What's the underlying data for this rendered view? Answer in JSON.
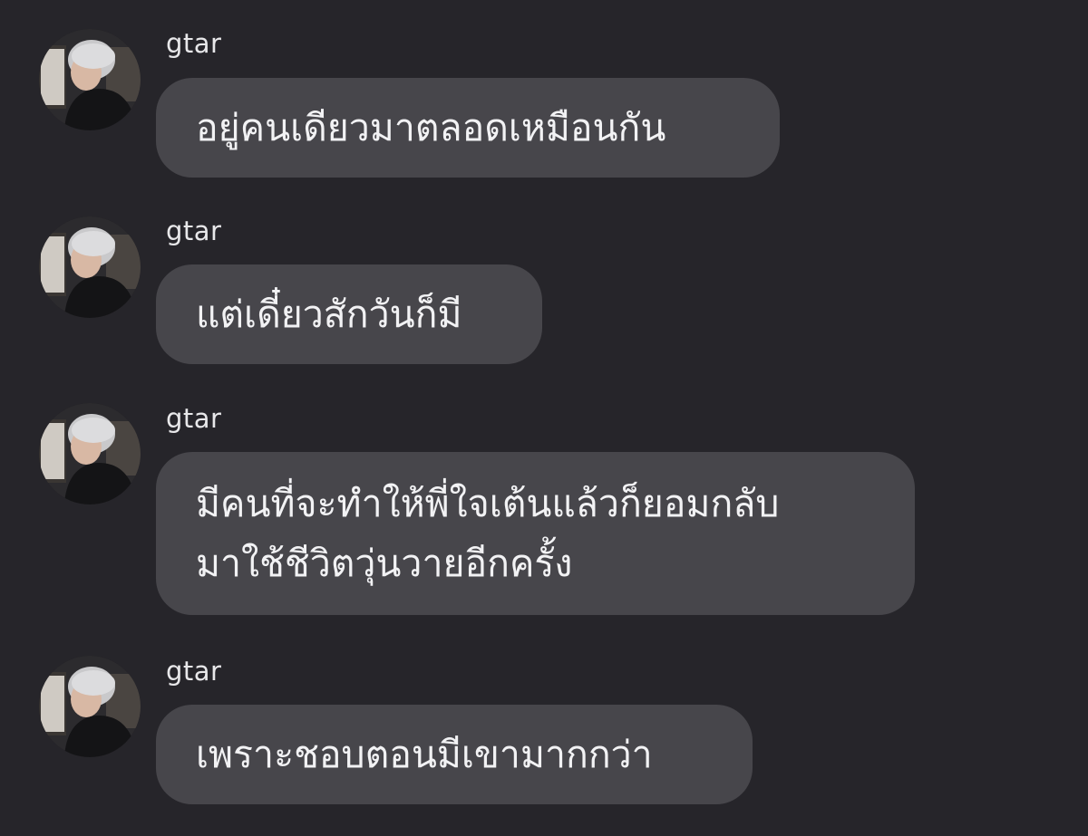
{
  "colors": {
    "background": "#26252a",
    "bubble": "#47464b",
    "text": "#f2f2f4",
    "sender": "#e8e8ea"
  },
  "messages": [
    {
      "sender": "gtar",
      "avatar_icon": "profile-photo-icon",
      "text": "อยู่คนเดียวมาตลอดเหมือนกัน"
    },
    {
      "sender": "gtar",
      "avatar_icon": "profile-photo-icon",
      "text": "แต่เดี๋ยวสักวันก็มี"
    },
    {
      "sender": "gtar",
      "avatar_icon": "profile-photo-icon",
      "text": "มีคนที่จะทำให้พี่ใจเต้นแล้วก็ยอมกลับ\nมาใช้ชีวิตวุ่นวายอีกครั้ง"
    },
    {
      "sender": "gtar",
      "avatar_icon": "profile-photo-icon",
      "text": "เพราะชอบตอนมีเขามากกว่า"
    }
  ]
}
